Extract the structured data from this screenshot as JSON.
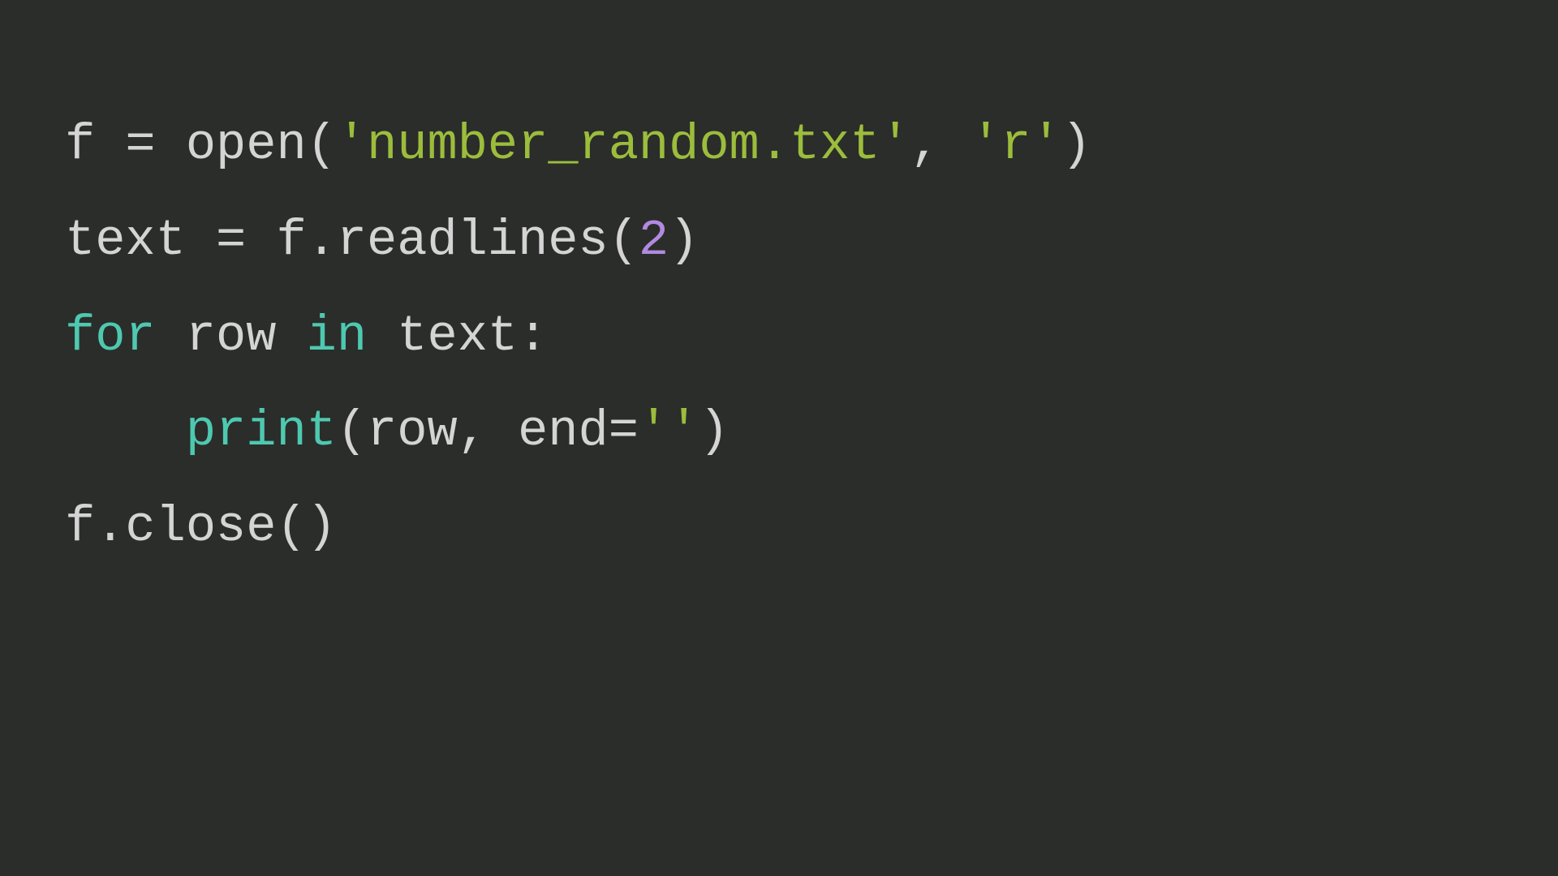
{
  "code": {
    "line1": {
      "t1": "f = ",
      "t2": "open",
      "t3": "(",
      "t4": "'number_random.txt'",
      "t5": ", ",
      "t6": "'r'",
      "t7": ")"
    },
    "line2": "",
    "line3": {
      "t1": "text = f.readlines(",
      "t2": "2",
      "t3": ")"
    },
    "line4": "",
    "line5": {
      "t1": "for",
      "t2": " row ",
      "t3": "in",
      "t4": " text:"
    },
    "line6": {
      "t1": "    ",
      "t2": "print",
      "t3": "(row, end=",
      "t4": "''",
      "t5": ")"
    },
    "line7": {
      "t1": "f.close()"
    }
  }
}
